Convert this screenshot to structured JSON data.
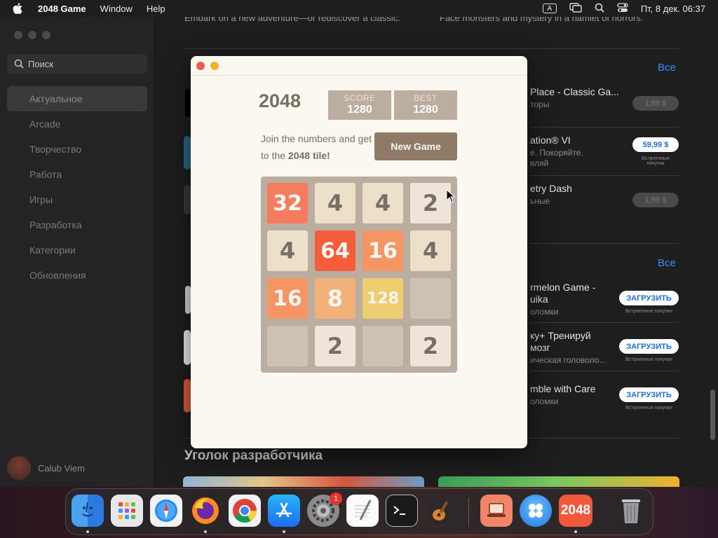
{
  "menubar": {
    "app_name": "2048 Game",
    "menu_window": "Window",
    "menu_help": "Help",
    "input_indicator": "A",
    "datetime": "Пт, 8 дек.  06:37"
  },
  "appstore": {
    "search_placeholder": "Поиск",
    "nav": [
      {
        "label": "Актуальное"
      },
      {
        "label": "Arcade"
      },
      {
        "label": "Творчество"
      },
      {
        "label": "Работа"
      },
      {
        "label": "Игры"
      },
      {
        "label": "Разработка"
      },
      {
        "label": "Категории"
      },
      {
        "label": "Обновления"
      }
    ],
    "user_name": "Calub Viem",
    "top_left_text": "Embark on a new adventure—or rediscover a classic.",
    "top_right_text": "Face monsters and mystery in a hamlet of horrors.",
    "see_all": "Все",
    "apps": [
      {
        "name": "Place - Classic Ga...",
        "sub": "торы",
        "price": "1,99 $",
        "inapp": ""
      },
      {
        "name": "ation® VI",
        "sub": "е. Покоряйте.",
        "sub2": "вляй",
        "price": "59,99 $",
        "inapp": "Встроенные покупки"
      },
      {
        "name": "etry Dash",
        "sub": "ьные",
        "price": "1,99 $",
        "inapp": ""
      },
      {
        "name": "rmelon Game -",
        "name2": "uika",
        "sub": "оломки",
        "price": "ЗАГРУЗИТЬ",
        "inapp": "Встроенные покупки"
      },
      {
        "name": "ку+ Тренируй",
        "name2": "мозг",
        "sub": "ическая головоло...",
        "price": "ЗАГРУЗИТЬ",
        "inapp": "Встроенные покупки"
      },
      {
        "name": "mble with Care",
        "sub": "оломки",
        "price": "ЗАГРУЗИТЬ",
        "inapp": "Встроенные покупки"
      }
    ],
    "dev_corner": "Уголок разработчика"
  },
  "game": {
    "title": "2048",
    "score_label": "SCORE",
    "score": "1280",
    "best_label": "BEST",
    "best": "1280",
    "intro_1": "Join the numbers and get to the ",
    "intro_bold": "2048 tile!",
    "new_game": "New Game",
    "board": [
      [
        32,
        4,
        4,
        2
      ],
      [
        4,
        64,
        16,
        4
      ],
      [
        16,
        8,
        128,
        0
      ],
      [
        0,
        2,
        0,
        2
      ]
    ]
  },
  "dock": {
    "items": [
      {
        "icon": "finder-icon"
      },
      {
        "icon": "launchpad-icon"
      },
      {
        "icon": "safari-icon"
      },
      {
        "icon": "firefox-icon"
      },
      {
        "icon": "chrome-icon"
      },
      {
        "icon": "app-store-icon"
      },
      {
        "icon": "system-settings-icon",
        "badge": "1"
      },
      {
        "icon": "textedit-icon"
      },
      {
        "icon": "terminal-icon"
      },
      {
        "icon": "garageband-icon"
      },
      {
        "icon": "remote-desktop-icon"
      },
      {
        "icon": "dots-app-icon"
      },
      {
        "icon": "game-2048-icon",
        "label": "2048"
      },
      {
        "icon": "trash-icon"
      }
    ]
  }
}
